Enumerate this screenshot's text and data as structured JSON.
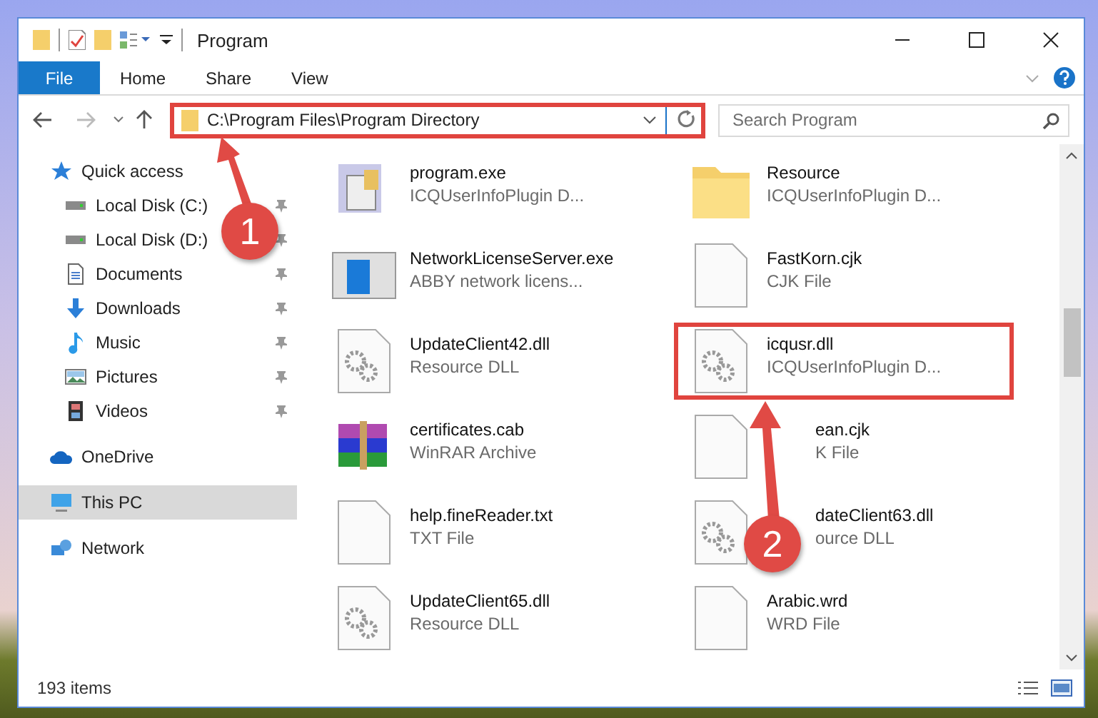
{
  "window": {
    "title": "Program"
  },
  "ribbon_tabs": [
    {
      "label": "File",
      "selected": true
    },
    {
      "label": "Home",
      "selected": false
    },
    {
      "label": "Share",
      "selected": false
    },
    {
      "label": "View",
      "selected": false
    }
  ],
  "address_bar": {
    "value": "C:\\Program Files\\Program Directory",
    "highlighted": true
  },
  "search": {
    "placeholder": "Search Program"
  },
  "sidebar": {
    "items": [
      {
        "label": "Quick access",
        "kind": "quick",
        "selected": false,
        "children": [
          {
            "label": "Local Disk (C:)",
            "kind": "drive",
            "pinned": true,
            "selected": false
          },
          {
            "label": "Local Disk (D:)",
            "kind": "drive",
            "pinned": true,
            "selected": false
          },
          {
            "label": "Documents",
            "kind": "documents",
            "pinned": true,
            "selected": false
          },
          {
            "label": "Downloads",
            "kind": "downloads",
            "pinned": true,
            "selected": false
          },
          {
            "label": "Music",
            "kind": "music",
            "pinned": true,
            "selected": false
          },
          {
            "label": "Pictures",
            "kind": "pictures",
            "pinned": true,
            "selected": false
          },
          {
            "label": "Videos",
            "kind": "videos",
            "pinned": true,
            "selected": false
          }
        ]
      },
      {
        "label": "OneDrive",
        "kind": "cloud",
        "selected": false
      },
      {
        "label": "This PC",
        "kind": "pc",
        "selected": true
      },
      {
        "label": "Network",
        "kind": "network",
        "selected": false
      }
    ]
  },
  "files": [
    {
      "name": "program.exe",
      "type": "ICQUserInfoPlugin D...",
      "kind": "exe",
      "highlighted": false,
      "partly_hidden": false
    },
    {
      "name": "Resource",
      "type": "ICQUserInfoPlugin D...",
      "kind": "folder",
      "highlighted": false,
      "partly_hidden": false
    },
    {
      "name": "NetworkLicenseServer.exe",
      "type": "ABBY network licens...",
      "kind": "app",
      "highlighted": false,
      "partly_hidden": false
    },
    {
      "name": "FastKorn.cjk",
      "type": "CJK File",
      "kind": "blank",
      "highlighted": false,
      "partly_hidden": false
    },
    {
      "name": "UpdateClient42.dll",
      "type": "Resource DLL",
      "kind": "dll",
      "highlighted": false,
      "partly_hidden": false
    },
    {
      "name": "icqusr.dll",
      "type": "ICQUserInfoPlugin D...",
      "kind": "dll",
      "highlighted": true,
      "partly_hidden": false
    },
    {
      "name": "certificates.cab",
      "type": "WinRAR Archive",
      "kind": "archive",
      "highlighted": false,
      "partly_hidden": false
    },
    {
      "name": "ean.cjk",
      "type": "K File",
      "kind": "blank",
      "highlighted": false,
      "partly_hidden": true
    },
    {
      "name": "help.fineReader.txt",
      "type": "TXT File",
      "kind": "blank",
      "highlighted": false,
      "partly_hidden": false
    },
    {
      "name": "dateClient63.dll",
      "type": "ource DLL",
      "kind": "dll",
      "highlighted": false,
      "partly_hidden": true
    },
    {
      "name": "UpdateClient65.dll",
      "type": "Resource DLL",
      "kind": "dll",
      "highlighted": false,
      "partly_hidden": false
    },
    {
      "name": "Arabic.wrd",
      "type": "WRD File",
      "kind": "blank",
      "highlighted": false,
      "partly_hidden": false
    }
  ],
  "status_bar": {
    "item_count": "193 items"
  },
  "callouts": [
    {
      "number": "1"
    },
    {
      "number": "2"
    }
  ]
}
